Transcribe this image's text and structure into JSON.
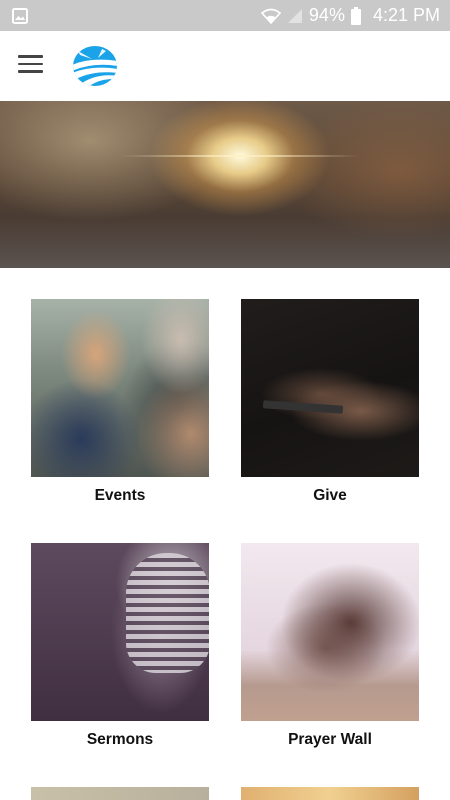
{
  "status_bar": {
    "battery_percent": "94%",
    "time": "4:21 PM",
    "icons": [
      "image-notification-icon",
      "wifi-icon",
      "signal-icon",
      "battery-icon"
    ]
  },
  "app_bar": {
    "menu_icon": "hamburger-menu-icon",
    "logo": "church-logo-icon",
    "logo_colors": [
      "#1aa3e8",
      "#0b7ec8",
      "#ffffff"
    ]
  },
  "hero": {
    "image": "sunlight-through-trees-photo"
  },
  "tiles": [
    {
      "label": "Events",
      "image": "people-gathering-photo"
    },
    {
      "label": "Give",
      "image": "hands-holding-phone-photo"
    },
    {
      "label": "Sermons",
      "image": "vintage-microphone-photo"
    },
    {
      "label": "Prayer Wall",
      "image": "praying-hands-photo"
    },
    {
      "label": "",
      "image": "partial-tile-photo"
    },
    {
      "label": "",
      "image": "partial-tile-photo"
    }
  ]
}
